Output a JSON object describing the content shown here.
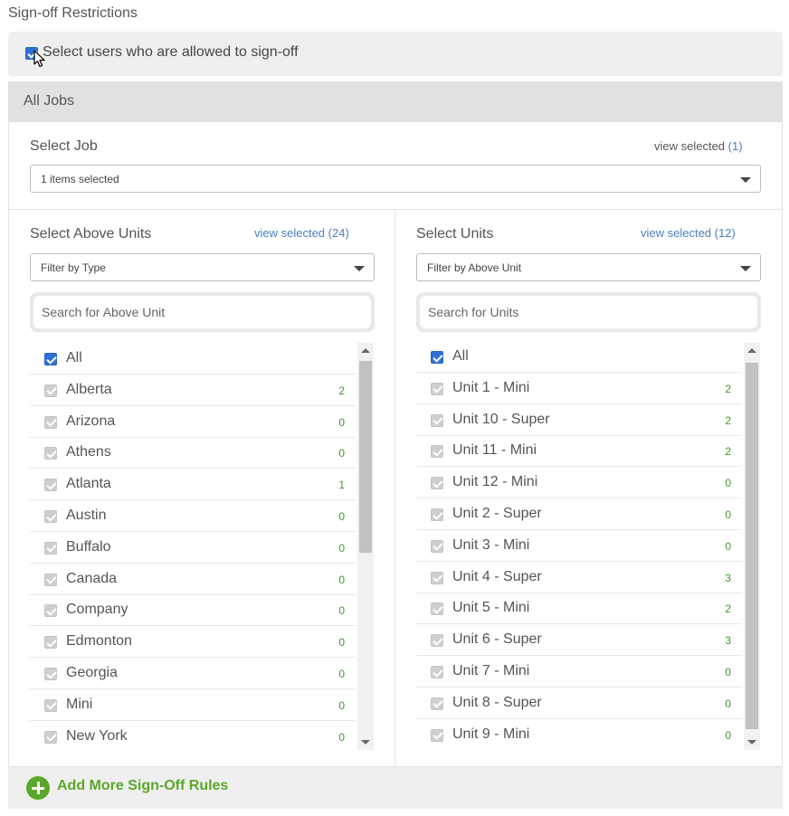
{
  "section_title": "Sign-off Restrictions",
  "signoff": {
    "checked": true,
    "label": "Select users who are allowed to sign-off"
  },
  "jobs_header": "All Jobs",
  "select_job": {
    "label": "Select Job",
    "view_selected_text": "view selected",
    "view_selected_count": "(1)",
    "dropdown_value": "1 items selected"
  },
  "above_units": {
    "label": "Select Above Units",
    "view_selected": "view selected (24)",
    "filter_value": "Filter by Type",
    "search_placeholder": "Search for Above Unit",
    "all_label": "All",
    "items": [
      {
        "name": "Alberta",
        "count": "2"
      },
      {
        "name": "Arizona",
        "count": "0"
      },
      {
        "name": "Athens",
        "count": "0"
      },
      {
        "name": "Atlanta",
        "count": "1"
      },
      {
        "name": "Austin",
        "count": "0"
      },
      {
        "name": "Buffalo",
        "count": "0"
      },
      {
        "name": "Canada",
        "count": "0"
      },
      {
        "name": "Company",
        "count": "0"
      },
      {
        "name": "Edmonton",
        "count": "0"
      },
      {
        "name": "Georgia",
        "count": "0"
      },
      {
        "name": "Mini",
        "count": "0"
      },
      {
        "name": "New York",
        "count": "0"
      }
    ]
  },
  "units": {
    "label": "Select Units",
    "view_selected": "view selected (12)",
    "filter_value": "Filter by Above Unit",
    "search_placeholder": "Search for Units",
    "all_label": "All",
    "items": [
      {
        "name": "Unit 1 - Mini",
        "count": "2"
      },
      {
        "name": "Unit 10 - Super",
        "count": "2"
      },
      {
        "name": "Unit 11 - Mini",
        "count": "2"
      },
      {
        "name": "Unit 12 - Mini",
        "count": "0"
      },
      {
        "name": "Unit 2 - Super",
        "count": "0"
      },
      {
        "name": "Unit 3 - Mini",
        "count": "0"
      },
      {
        "name": "Unit 4 - Super",
        "count": "3"
      },
      {
        "name": "Unit 5 - Mini",
        "count": "2"
      },
      {
        "name": "Unit 6 - Super",
        "count": "3"
      },
      {
        "name": "Unit 7 - Mini",
        "count": "0"
      },
      {
        "name": "Unit 8 - Super",
        "count": "0"
      },
      {
        "name": "Unit 9 - Mini",
        "count": "0"
      }
    ]
  },
  "add_rules": "Add More Sign-Off Rules",
  "colors": {
    "accent_blue": "#2f6fd6",
    "link_blue": "#4a7fc1",
    "count_green": "#3d9a2a",
    "add_green": "#5aa829"
  },
  "icons": [
    "checkbox-icon",
    "cursor-icon",
    "chevron-down-icon",
    "scroll-up-icon",
    "scroll-down-icon",
    "plus-circle-icon"
  ]
}
